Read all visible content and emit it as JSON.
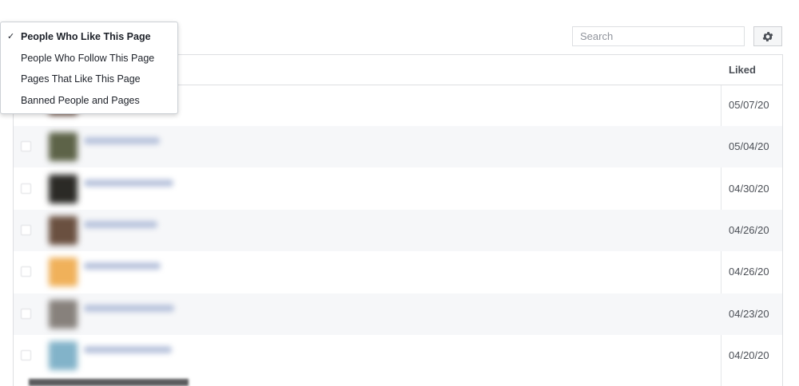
{
  "filter_menu": {
    "check_mark": "✓",
    "items": [
      {
        "label": "People Who Like This Page",
        "selected": true
      },
      {
        "label": "People Who Follow This Page",
        "selected": false
      },
      {
        "label": "Pages That Like This Page",
        "selected": false
      },
      {
        "label": "Banned People and Pages",
        "selected": false
      }
    ]
  },
  "search": {
    "placeholder": "Search",
    "value": ""
  },
  "settings": {
    "icon": "gear-icon"
  },
  "table": {
    "columns": {
      "liked": "Liked"
    },
    "rows": [
      {
        "liked": "05/07/20",
        "avatar_color": "#5b3a2c"
      },
      {
        "liked": "05/04/20",
        "avatar_color": "#5d6348"
      },
      {
        "liked": "04/30/20",
        "avatar_color": "#2b2a26"
      },
      {
        "liked": "04/26/20",
        "avatar_color": "#6a5040"
      },
      {
        "liked": "04/26/20",
        "avatar_color": "#f0b15a"
      },
      {
        "liked": "04/23/20",
        "avatar_color": "#87817c"
      },
      {
        "liked": "04/20/20",
        "avatar_color": "#82b3c9"
      }
    ]
  },
  "colors": {
    "link_blur": "#b8c3dc",
    "row_alt": "#f6f7f9",
    "border": "#dddfe2"
  }
}
